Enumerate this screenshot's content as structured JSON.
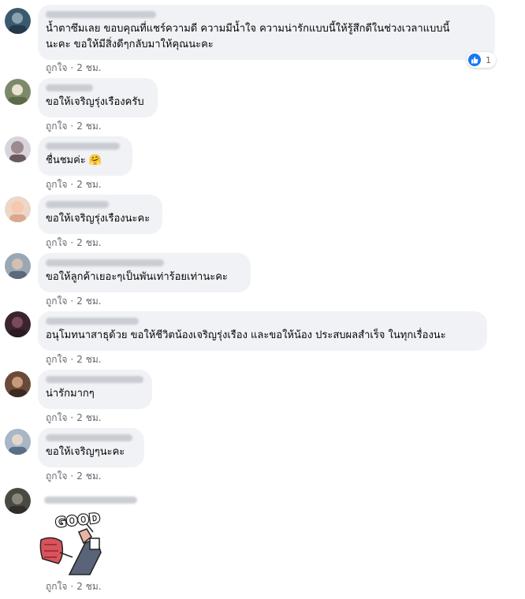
{
  "colors": {
    "bubble": "#f0f2f5",
    "meta_text": "#65676b",
    "like_blue": "#1877f2"
  },
  "comments": [
    {
      "text": "น้ำตาซึมเลย ขอบคุณที่แชร์ความดี ความมีน้ำใจ ความน่ารักแบบนี้ให้รู้สึกดีในช่วงเวลาแบบนี้\nนะคะ ขอให้มีสิ่งดีๆกลับมาให้คุณนะคะ",
      "like": "ถูกใจ",
      "time": "2 ชม.",
      "reaction_count": "1",
      "reaction_icon": "thumbs-up-icon"
    },
    {
      "text": "ขอให้เจริญรุ่งเรืองครับ",
      "like": "ถูกใจ",
      "time": "2 ชม."
    },
    {
      "text": "ชื่นชมค่ะ 🤗",
      "like": "ถูกใจ",
      "time": "2 ชม."
    },
    {
      "text": "ขอให้เจริญรุ่งเรืองนะคะ",
      "like": "ถูกใจ",
      "time": "2 ชม."
    },
    {
      "text": "ขอให้ลูกค้าเยอะๆเป็นพันเท่าร้อยเท่านะคะ",
      "like": "ถูกใจ",
      "time": "2 ชม."
    },
    {
      "text": "อนุโมทนาสาธุด้วย ขอให้ชีวิตน้องเจริญรุ่งเรือง และขอให้น้อง ประสบผลสำเร็จ ในทุกเรื่องนะ",
      "like": "ถูกใจ",
      "time": "2 ชม."
    },
    {
      "text": "น่ารักมากๆ",
      "like": "ถูกใจ",
      "time": "2 ชม."
    },
    {
      "text": "ขอให้เจริญๆนะคะ",
      "like": "ถูกใจ",
      "time": "2 ชม."
    },
    {
      "sticker_text": "GOOD",
      "like": "ถูกใจ",
      "time": "2 ชม."
    }
  ],
  "separator": "·"
}
